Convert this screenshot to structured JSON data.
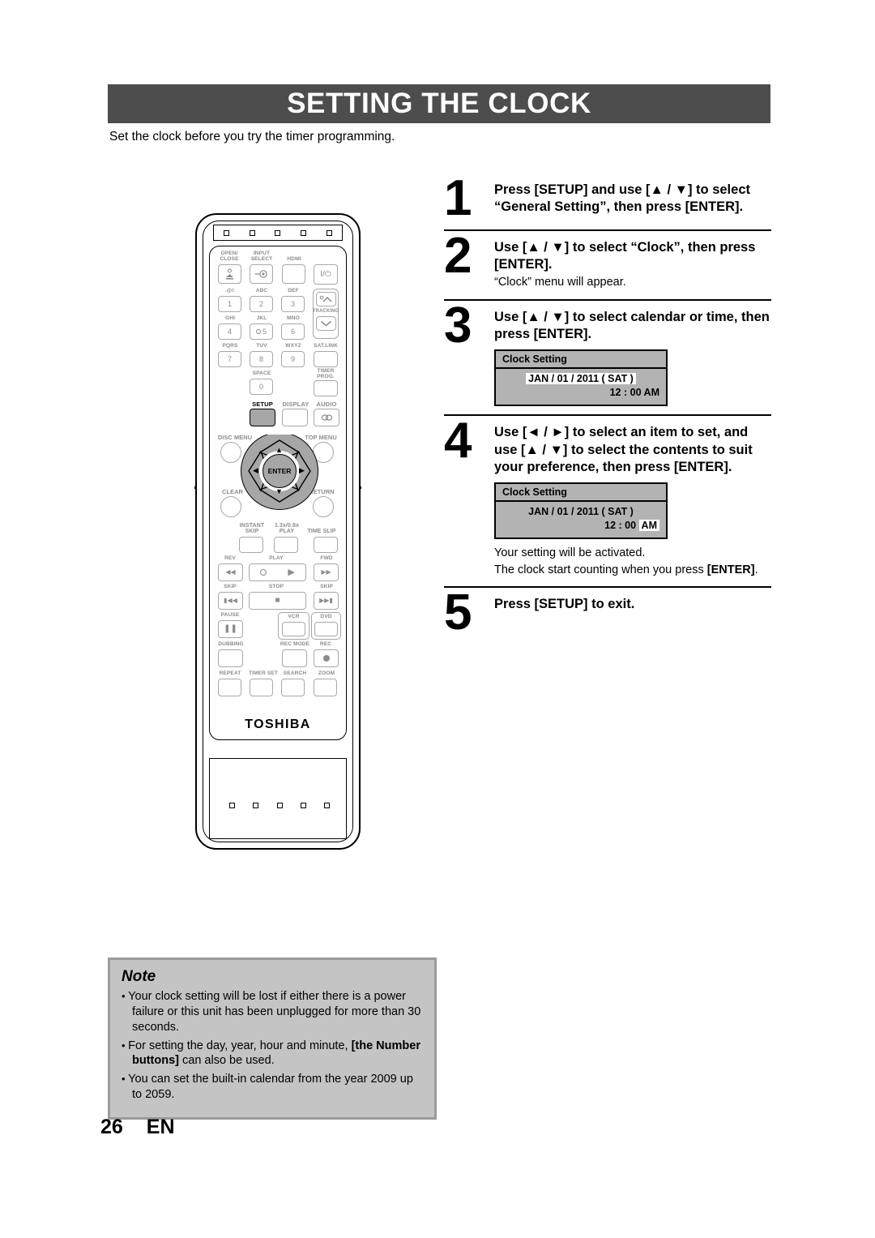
{
  "page": {
    "title": "SETTING THE CLOCK",
    "intro": "Set the clock before you try the timer programming.",
    "page_number": "26",
    "language_code": "EN"
  },
  "steps": [
    {
      "number": "1",
      "text": "Press [SETUP] and use [▲ / ▼] to select “General Setting”, then press [ENTER].",
      "sub": "",
      "sub2": ""
    },
    {
      "number": "2",
      "text": "Use [▲ / ▼] to select “Clock”, then press [ENTER].",
      "sub": "“Clock” menu will appear.",
      "sub2": ""
    },
    {
      "number": "3",
      "text": "Use [▲ / ▼] to select calendar or time, then press [ENTER].",
      "sub": "",
      "sub2": ""
    },
    {
      "number": "4",
      "text": "Use [◄ / ►] to select an item to set, and use [▲ / ▼] to select the contents to suit your preference, then press [ENTER].",
      "sub": "Your setting will be activated.",
      "sub2": "The clock start counting when you press ",
      "sub2_bold": "[ENTER]",
      "sub2_tail": "."
    },
    {
      "number": "5",
      "text": "Press [SETUP] to exit.",
      "sub": "",
      "sub2": ""
    }
  ],
  "osd_step3": {
    "title": "Clock Setting",
    "date": "JAN / 01 / 2011 ( SAT )",
    "time": "12 : 00",
    "meridiem": "AM",
    "highlight": "date"
  },
  "osd_step4": {
    "title": "Clock Setting",
    "date": "JAN / 01 / 2011 ( SAT )",
    "time": "12 : 00",
    "meridiem": "AM",
    "highlight": "meridiem"
  },
  "note": {
    "heading": "Note",
    "items": [
      {
        "pre": "Your clock setting will be lost if either there is a power failure or this unit has been unplugged for more than 30 seconds.",
        "bold": "",
        "post": ""
      },
      {
        "pre": "For setting the day, year, hour and minute, ",
        "bold": "[the Number buttons]",
        "post": " can also be used."
      },
      {
        "pre": "You can set the built-in calendar from the year 2009 up to 2059.",
        "bold": "",
        "post": ""
      }
    ]
  },
  "remote": {
    "brand": "TOSHIBA",
    "labels": {
      "open_close": "OPEN/\nCLOSE",
      "input_select": "INPUT\nSELECT",
      "hdmi": "HDMI",
      "power": "I/⏻",
      "k1_sub": ".@/:",
      "k2_sub": "ABC",
      "k3_sub": "DEF",
      "k4_sub": "GHI",
      "k5_sub": "JKL",
      "k6_sub": "MNO",
      "k7_sub": "PQRS",
      "k8_sub": "TUV",
      "k9_sub": "WXYZ",
      "k0_sub": "SPACE",
      "tracking": "TRACKING",
      "satlink": "SAT.LINK",
      "timer_prog": "TIMER\nPROG.",
      "setup": "SETUP",
      "display": "DISPLAY",
      "audio": "AUDIO",
      "disc_menu": "DISC MENU",
      "top_menu": "TOP MENU",
      "clear": "CLEAR",
      "return": "RETURN",
      "enter": "ENTER",
      "instant_skip": "INSTANT\nSKIP",
      "speed_play": "1.3x/0.8x\nPLAY",
      "time_slip": "TIME SLIP",
      "rev": "REV",
      "play": "PLAY",
      "fwd": "FWD",
      "skip_back": "SKIP",
      "stop": "STOP",
      "skip_fwd": "SKIP",
      "pause": "PAUSE",
      "vcr": "VCR",
      "dvd": "DVD",
      "dubbing": "DUBBING",
      "rec_mode": "REC MODE",
      "rec": "REC",
      "repeat": "REPEAT",
      "timer_set": "TIMER SET",
      "search": "SEARCH",
      "zoom": "ZOOM"
    },
    "digits": {
      "one": "1",
      "two": "2",
      "three": "3",
      "four": "4",
      "five": "5",
      "six": "6",
      "seven": "7",
      "eight": "8",
      "nine": "9",
      "zero": "0"
    }
  },
  "colors": {
    "title_bar": "#4d4d4d",
    "note_bg": "#c4c4c4",
    "note_border": "#9b9b9b",
    "osd_bg": "#b3b3b3",
    "highlight_bg": "#ffffff",
    "selected_key": "#a6a6a6"
  }
}
